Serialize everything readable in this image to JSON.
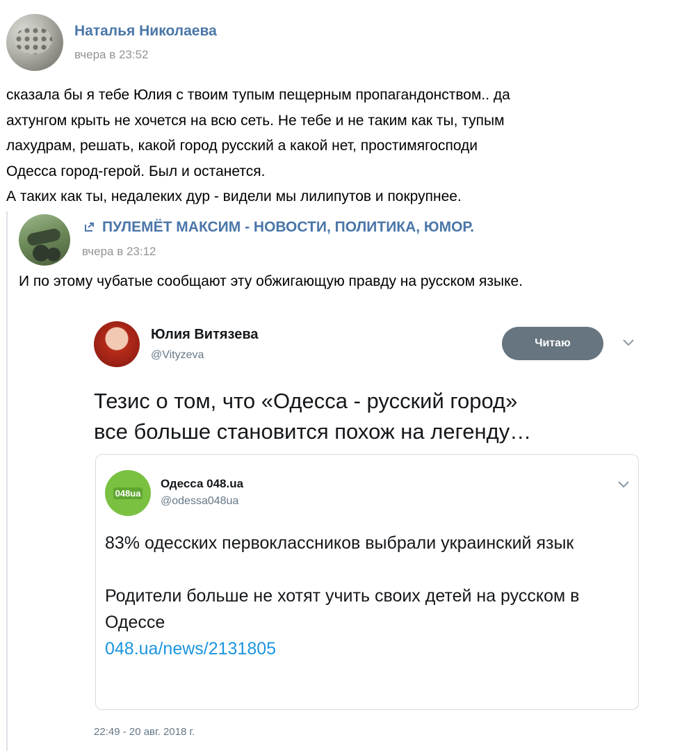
{
  "post": {
    "author": "Наталья Николаева",
    "time": "вчера в 23:52",
    "text": "сказала бы я тебе Юлия с твоим тупым пещерным пропагандонством.. да\nахтунгом крыть не хочется на всю сеть. Не тебе и не таким как ты, тупым\nлахудрам, решать, какой город русский а какой нет, простимягосподи\n Одесса город-герой. Был и останется.\nА таких как ты, недалеких дур - видели мы лилипутов и покрупнее."
  },
  "repost": {
    "author": "ПУЛЕМЁТ МАКСИМ -  НОВОСТИ, ПОЛИТИКА, ЮМОР.",
    "time": "вчера в 23:12",
    "text": "И по этому чубатые сообщают эту обжигающую правду на русском языке."
  },
  "tweet": {
    "name": "Юлия Витязева",
    "handle": "@Vityzeva",
    "follow_label": "Читаю",
    "text": "Тезис о том, что «Одесса - русский город»\nвсе больше становится похож на легенду…",
    "date": "22:49 - 20 авг. 2018 г.",
    "quoted": {
      "avatar_text": "048ua",
      "name": "Одесса 048.ua",
      "handle": "@odessa048ua",
      "line1": "83% одесских первоклассников выбрали украинский язык",
      "line2": "Родители больше не хотят учить своих детей на русском в Одессе",
      "link": "048.ua/news/2131805"
    }
  },
  "colors": {
    "link_blue": "#4a76a8",
    "meta_gray": "#939393",
    "twitter_link": "#1b95e0",
    "follow_button": "#66757f"
  },
  "icons": [
    "repost-arrow-icon",
    "chevron-down-icon"
  ]
}
